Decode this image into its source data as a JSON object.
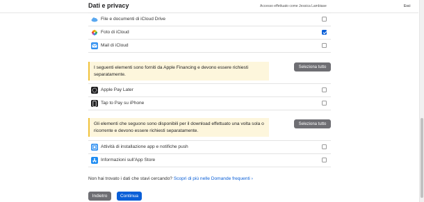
{
  "header": {
    "title": "Dati e privacy",
    "account_text": "Accesso effettuato come Jessica Lambiase",
    "signout": "Esci"
  },
  "icloud_items": [
    {
      "label": "File e documenti di iCloud Drive",
      "checked": false,
      "icon": "icloud-drive-icon"
    },
    {
      "label": "Foto di iCloud",
      "checked": true,
      "icon": "photos-icon"
    },
    {
      "label": "Mail di iCloud",
      "checked": false,
      "icon": "mail-icon"
    }
  ],
  "financing": {
    "notice": "I seguenti elementi sono forniti da Apple Financing e devono essere richiesti separatamente.",
    "select_all": "Seleziona tutto",
    "items": [
      {
        "label": "Apple Pay Later",
        "checked": false,
        "icon": "apple-pay-later-icon"
      },
      {
        "label": "Tap to Pay su iPhone",
        "checked": false,
        "icon": "tap-to-pay-icon"
      }
    ]
  },
  "onetime": {
    "notice": "Gli elementi che seguono sono disponibili per il download effettuato una volta sola o ricorrente e devono essere richiesti separatamente.",
    "select_all": "Seleziona tutto",
    "items": [
      {
        "label": "Attività di installazione app e notifiche push",
        "checked": false,
        "icon": "app-install-icon"
      },
      {
        "label": "Informazioni sull'App Store",
        "checked": false,
        "icon": "app-store-icon"
      }
    ]
  },
  "faq": {
    "text": "Non hai trovato i dati che stavi cercando?",
    "link": "Scopri di più nelle Domande frequenti ›"
  },
  "footer": {
    "back": "Indietro",
    "continue": "Continua"
  },
  "colors": {
    "accent": "#0a5fd7",
    "notice_bg": "#fdf6dc",
    "notice_border": "#f0c23b",
    "secondary_button": "#6e6e73"
  }
}
